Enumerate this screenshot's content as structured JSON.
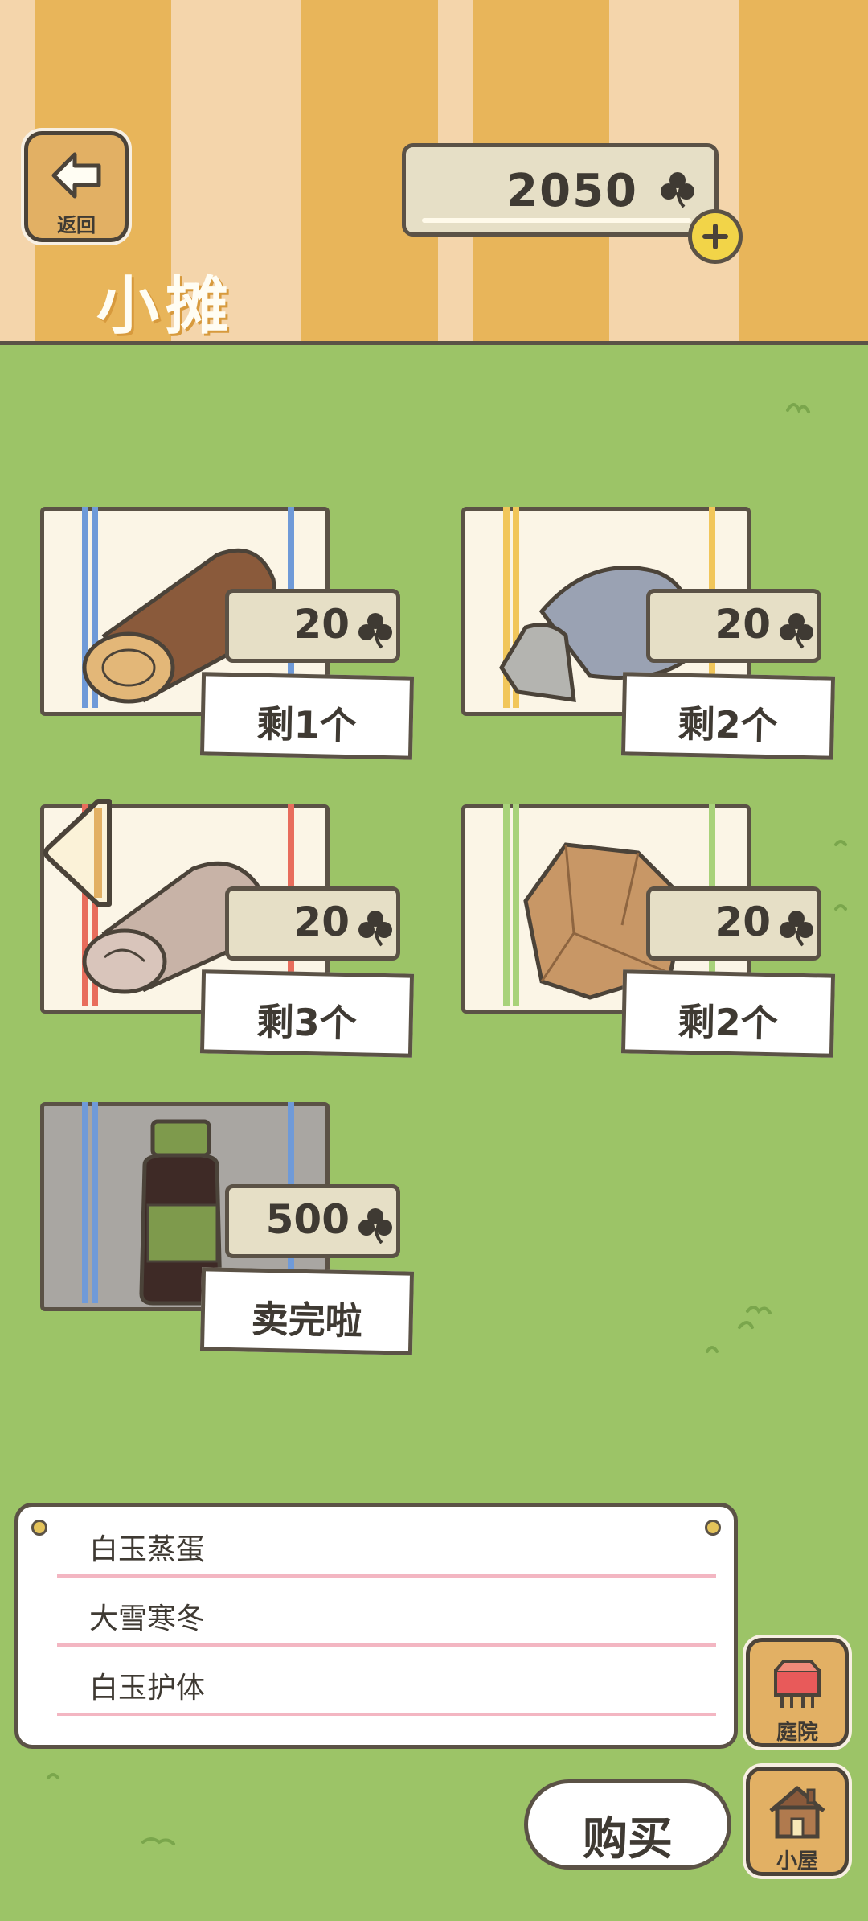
{
  "header": {
    "back_label": "返回",
    "coin_balance": "2050",
    "title": "小摊"
  },
  "shop_items": [
    {
      "name": "wood-log",
      "price": "20",
      "stock": "剩1个",
      "stripe_color": "#6f9ad8"
    },
    {
      "name": "stone",
      "price": "20",
      "stock": "剩2个",
      "stripe_color": "#f1c65a"
    },
    {
      "name": "cloth-roll",
      "price": "20",
      "stock": "剩3个",
      "stripe_color": "#e86d5c"
    },
    {
      "name": "paper-bag",
      "price": "20",
      "stock": "剩2个",
      "stripe_color": "#a8d27a"
    },
    {
      "name": "medicine-bottle",
      "price": "500",
      "stock": "卖完啦",
      "stripe_color": "#6f9ad8"
    }
  ],
  "list_panel": {
    "items": [
      "白玉蒸蛋",
      "大雪寒冬",
      "白玉护体"
    ]
  },
  "side_buttons": {
    "yard_label": "庭院",
    "house_label": "小屋"
  },
  "buy_label": "购买",
  "colors": {
    "grass": "#9cc467",
    "outline": "#5b5246",
    "wood": "#e2b064"
  }
}
